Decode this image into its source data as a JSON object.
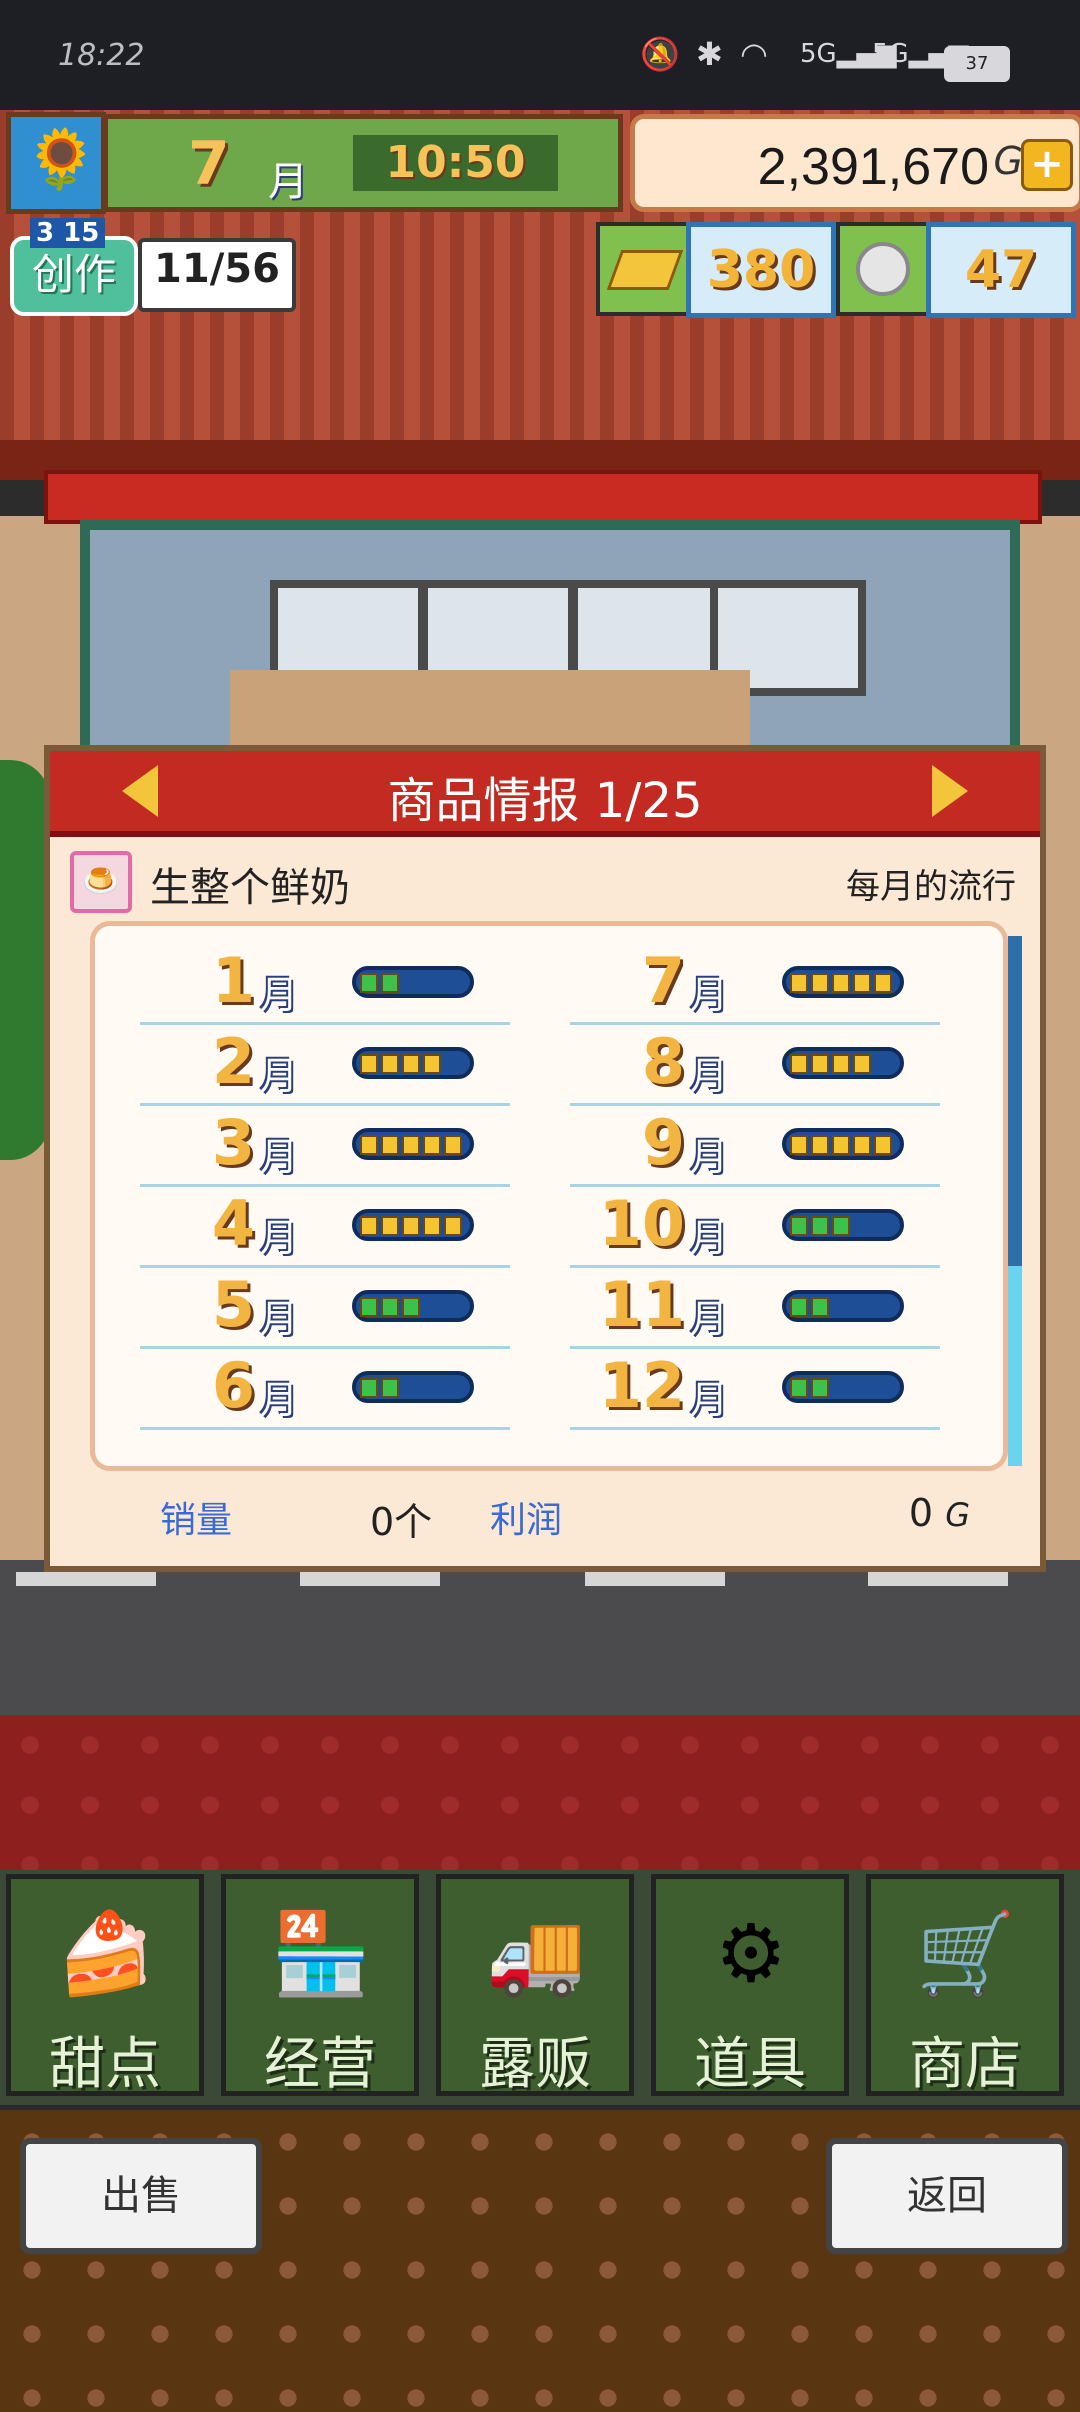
{
  "status_bar": {
    "time": "18:22",
    "battery": "37"
  },
  "hud": {
    "month": "7",
    "month_unit": "月",
    "clock": "10:50",
    "money": "2,391,670",
    "money_unit": "G",
    "plus": "+",
    "create_level": "3 15",
    "create_label": "创作",
    "create_progress": "11/56",
    "gold_count": "380",
    "medal_count": "47"
  },
  "dialog": {
    "title": "商品情报 1/25",
    "product_name": "生整个鲜奶",
    "trend_label": "每月的流行",
    "month_unit": "月",
    "months": [
      {
        "month": "1",
        "level": 2
      },
      {
        "month": "2",
        "level": 4
      },
      {
        "month": "3",
        "level": 5
      },
      {
        "month": "4",
        "level": 5
      },
      {
        "month": "5",
        "level": 3
      },
      {
        "month": "6",
        "level": 2
      },
      {
        "month": "7",
        "level": 5
      },
      {
        "month": "8",
        "level": 4
      },
      {
        "month": "9",
        "level": 5
      },
      {
        "month": "10",
        "level": 3
      },
      {
        "month": "11",
        "level": 2
      },
      {
        "month": "12",
        "level": 2
      }
    ],
    "sales_label": "销量",
    "sales_value": "0个",
    "profit_label": "利润",
    "profit_value": "0",
    "profit_unit": "G"
  },
  "menu": [
    {
      "label": "甜点",
      "icon": "cake-icon"
    },
    {
      "label": "经营",
      "icon": "shop-building-icon"
    },
    {
      "label": "露贩",
      "icon": "food-truck-icon"
    },
    {
      "label": "道具",
      "icon": "gear-bag-icon"
    },
    {
      "label": "商店",
      "icon": "shopping-cart-icon"
    }
  ],
  "buttons": {
    "sell": "出售",
    "back": "返回"
  },
  "colors": {
    "accent_red": "#c22a22",
    "bar_yellow": "#f4c531",
    "bar_green": "#3cc24a",
    "bar_bg": "#1e4f96"
  }
}
